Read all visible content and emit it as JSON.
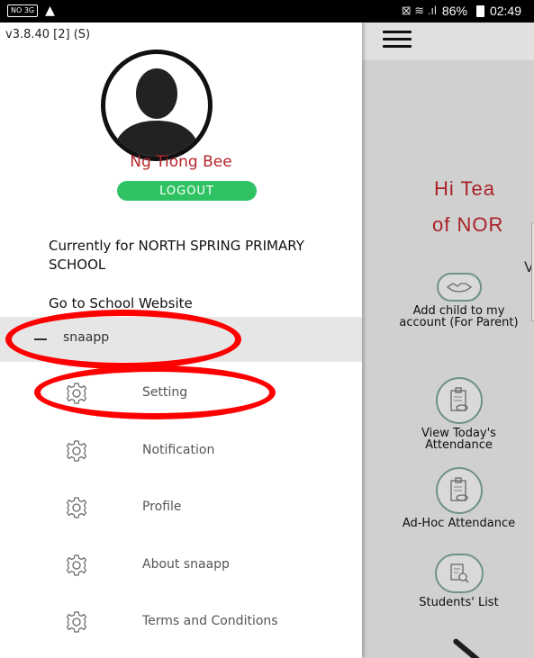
{
  "status_bar": {
    "left_badge": "NO 3G",
    "warning_glyph": "▲",
    "signal_text": "⊠ ≋ .ıl",
    "battery": "86%",
    "time": "02:49"
  },
  "drawer": {
    "version": "v3.8.40 [2] (S)",
    "user_name": "Ng Tiong Bee",
    "logout_label": "LOGOUT",
    "current_school": "Currently for NORTH SPRING PRIMARY SCHOOL",
    "website_link": "Go to School Website",
    "group_label": "snaapp",
    "items": [
      {
        "label": "Setting",
        "icon": "gear-icon"
      },
      {
        "label": "Notification",
        "icon": "gear-icon"
      },
      {
        "label": "Profile",
        "icon": "gear-icon"
      },
      {
        "label": "About snaapp",
        "icon": "gear-icon"
      },
      {
        "label": "Terms and Conditions",
        "icon": "gear-icon"
      }
    ]
  },
  "main": {
    "greeting_line1": "Hi Tea",
    "greeting_line2": "of NOR",
    "greeting_line3": "V",
    "features": [
      {
        "label": "Add child to my account (For Parent)",
        "icon": "handshake-icon"
      },
      {
        "label": "View Today's Attendance",
        "icon": "clipboard-eye-icon"
      },
      {
        "label": "Ad-Hoc Attendance",
        "icon": "clipboard-eye-icon"
      },
      {
        "label": "Students' List",
        "icon": "document-search-icon"
      }
    ]
  },
  "colors": {
    "accent_red": "#c1272d",
    "logout_green": "#2fc263",
    "annotation_red": "#ff0000"
  }
}
